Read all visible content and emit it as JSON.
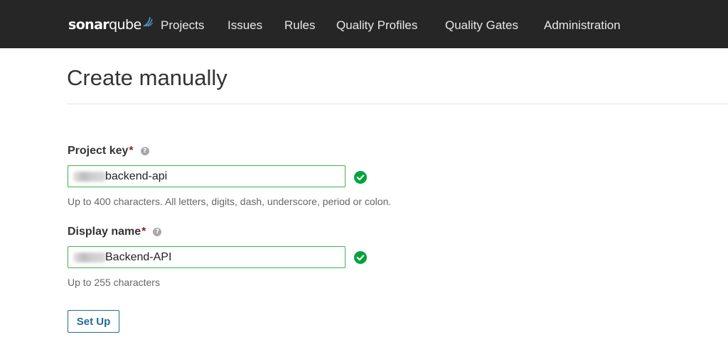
{
  "header": {
    "logo": {
      "part1": "sonar",
      "part2": "qube"
    },
    "nav": [
      "Projects",
      "Issues",
      "Rules",
      "Quality Profiles",
      "Quality Gates",
      "Administration"
    ]
  },
  "page": {
    "title": "Create manually"
  },
  "form": {
    "project_key": {
      "label": "Project key",
      "required_mark": "*",
      "value": "backend-api",
      "hint": "Up to 400 characters. All letters, digits, dash, underscore, period or colon."
    },
    "display_name": {
      "label": "Display name",
      "required_mark": "*",
      "value": "Backend-API",
      "hint": "Up to 255 characters"
    },
    "submit_label": "Set Up"
  },
  "colors": {
    "topbar": "#262626",
    "valid_green": "#00a33b",
    "input_border": "#39b54a",
    "button_blue": "#236a97",
    "required_red": "#9b1c1c"
  },
  "icons": {
    "help": "question-circle-icon",
    "valid": "check-circle-icon",
    "logo_waves": "sonar-waves-icon"
  }
}
